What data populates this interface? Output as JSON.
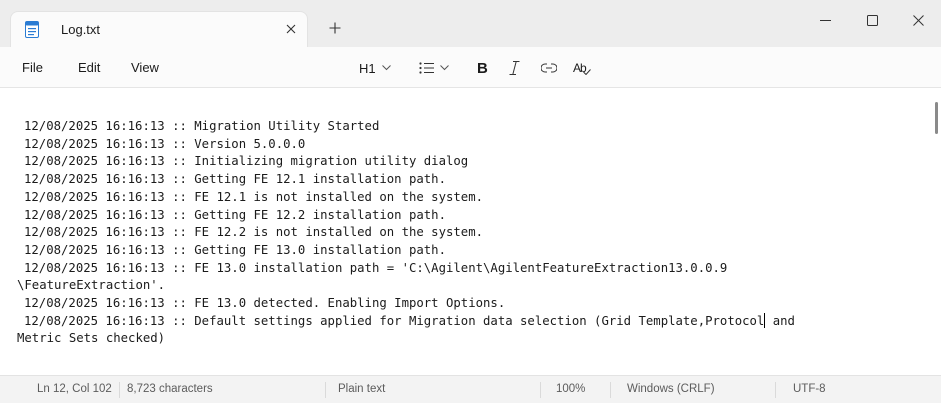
{
  "tab": {
    "title": "Log.txt",
    "close_glyph": "✕",
    "new_tab_glyph": "+"
  },
  "window_controls": {
    "minimize": "—",
    "maximize": "☐",
    "close": "✕"
  },
  "menu": {
    "file": "File",
    "edit": "Edit",
    "view": "View"
  },
  "format_toolbar": {
    "heading": "H1",
    "bold": "B",
    "italic": "I",
    "spellcheck": "Ab"
  },
  "editor": {
    "lines": [
      "12/08/2025 16:16:13 :: Migration Utility Started",
      "12/08/2025 16:16:13 :: Version 5.0.0.0",
      "12/08/2025 16:16:13 :: Initializing migration utility dialog",
      "12/08/2025 16:16:13 :: Getting FE 12.1 installation path.",
      "12/08/2025 16:16:13 :: FE 12.1 is not installed on the system.",
      "12/08/2025 16:16:13 :: Getting FE 12.2 installation path.",
      "12/08/2025 16:16:13 :: FE 12.2 is not installed on the system.",
      "12/08/2025 16:16:13 :: Getting FE 13.0 installation path.",
      "12/08/2025 16:16:13 :: FE 13.0 installation path = 'C:\\Agilent\\AgilentFeatureExtraction13.0.0.9",
      "\\FeatureExtraction'.",
      "12/08/2025 16:16:13 :: FE 13.0 detected. Enabling Import Options.",
      "12/08/2025 16:16:13 :: Default settings applied for Migration data selection (Grid Template,Protocol",
      " and",
      "Metric Sets checked)"
    ]
  },
  "status": {
    "position": "Ln 12, Col 102",
    "characters": "8,723 characters",
    "file_type": "Plain text",
    "zoom": "100%",
    "line_ending": "Windows (CRLF)",
    "encoding": "UTF-8"
  },
  "colors": {
    "file_icon": "#2b7cd3",
    "titlebar": "#ededed",
    "tab": "#fbfbfb"
  }
}
